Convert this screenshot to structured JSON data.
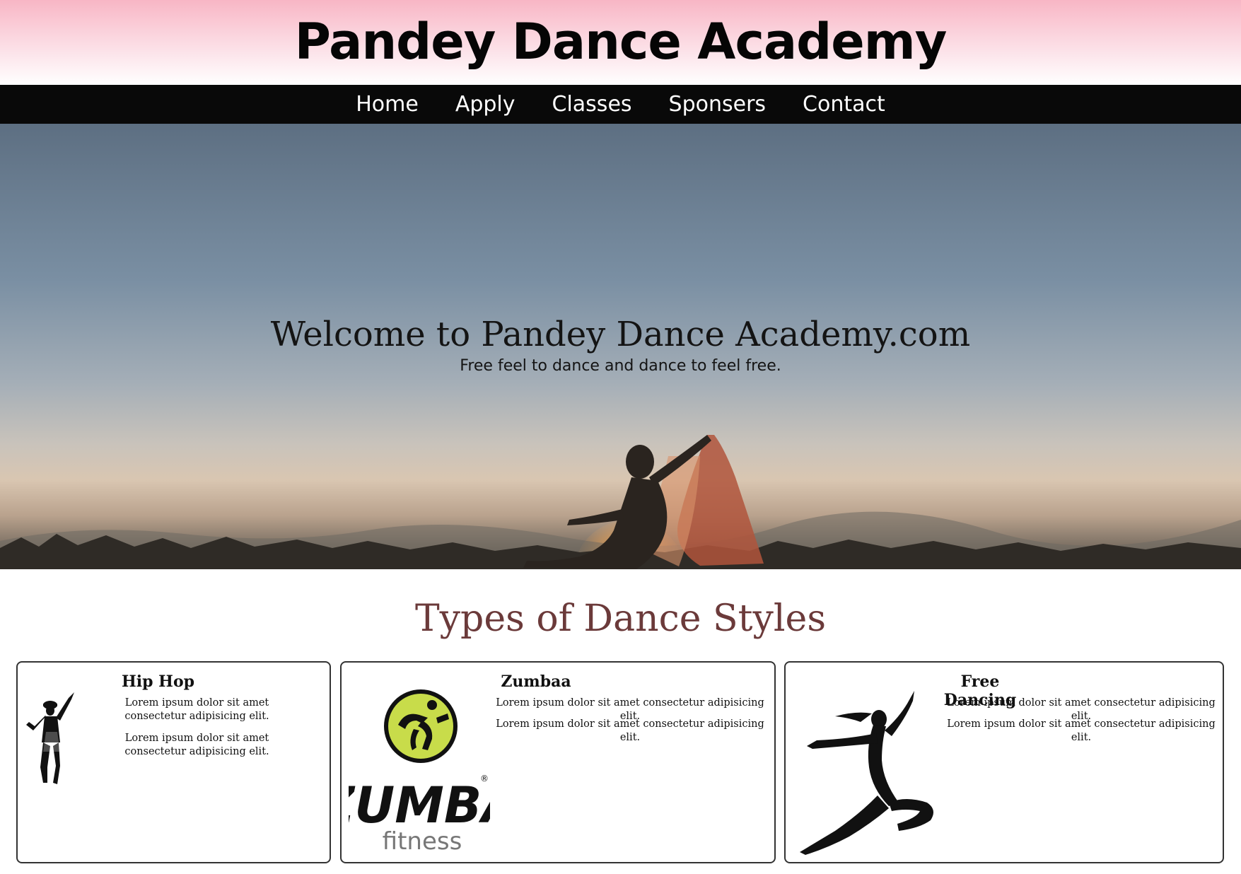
{
  "header": {
    "title": "Pandey Dance Academy"
  },
  "nav": {
    "items": [
      "Home",
      "Apply",
      "Classes",
      "Sponsers",
      "Contact"
    ]
  },
  "hero": {
    "heading": "Welcome to Pandey Dance Academy.com",
    "tagline": "Free feel to dance and dance to feel free."
  },
  "styles_section": {
    "heading": "Types of Dance Styles",
    "cards": [
      {
        "title": "Hip Hop",
        "paragraphs": [
          "Lorem ipsum dolor sit amet consectetur adipisicing elit.",
          "Lorem ipsum dolor sit amet consectetur adipisicing elit."
        ]
      },
      {
        "title": "Zumbaa",
        "paragraphs": [
          "Lorem ipsum dolor sit amet consectetur adipisicing elit.",
          "Lorem ipsum dolor sit amet consectetur adipisicing elit."
        ],
        "logo": {
          "word": "ZUMBA",
          "registered": "®",
          "sub": "fitness"
        }
      },
      {
        "title": "Free Dancing",
        "paragraphs": [
          "Lorem ipsum dolor sit amet consectetur adipisicing elit.",
          "Lorem ipsum dolor sit amet consectetur adipisicing elit."
        ]
      }
    ]
  },
  "colors": {
    "header_gradient_top": "#f8b6c5",
    "nav_background": "#090909",
    "section_heading": "#6b3a3a",
    "zumba_green": "#c8dc4a"
  }
}
